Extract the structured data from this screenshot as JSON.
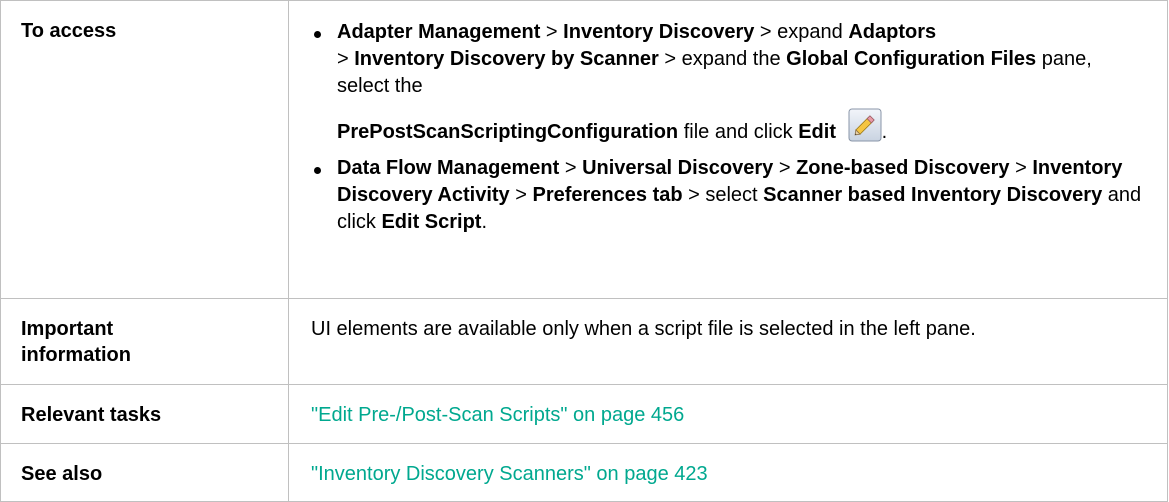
{
  "rows": {
    "access": {
      "label": "To access",
      "bullet1": {
        "p1": "Adapter Management",
        "s1": " > ",
        "p2": "Inventory Discovery",
        "s2": " > expand ",
        "p3": "Adaptors",
        "s3": " > ",
        "p4": "Inventory Discovery by Scanner",
        "s4": " > expand the ",
        "p5": "Global Configuration Files",
        "s5": " pane, select the ",
        "p6": "PrePostScanScriptingConfiguration",
        "s6": " file and click ",
        "p7": "Edit",
        "s7": "."
      },
      "bullet2": {
        "p1": "Data Flow Management",
        "s1": " > ",
        "p2": "Universal Discovery",
        "s2": " > ",
        "p3": "Zone-based Discovery",
        "s3": " > ",
        "p4": "Inventory Discovery Activity",
        "s4": " > ",
        "p5": "Preferences tab",
        "s5": " > select ",
        "p6": "Scanner based Inventory Discovery",
        "s6": " and click ",
        "p7": "Edit Script",
        "s7": "."
      }
    },
    "important": {
      "label": "Important information",
      "text": "UI elements are available only when a script file is selected in the left pane."
    },
    "tasks": {
      "label": "Relevant tasks",
      "link": "\"Edit Pre-/Post-Scan Scripts\" on page 456"
    },
    "see_also": {
      "label": "See also",
      "link": "\"Inventory Discovery Scanners\" on page 423"
    }
  },
  "icons": {
    "edit": "pencil-icon"
  },
  "colors": {
    "link": "#00a88f",
    "border": "#c0c0c0"
  }
}
